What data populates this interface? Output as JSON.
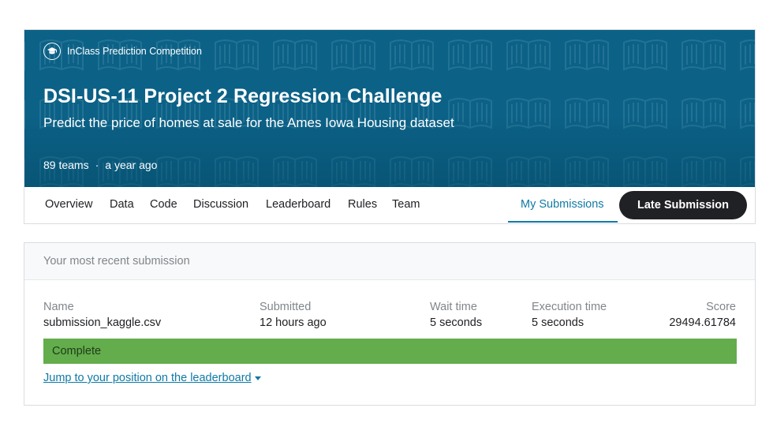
{
  "competition": {
    "type_label": "InClass Prediction Competition",
    "title": "DSI-US-11 Project 2 Regression Challenge",
    "subtitle": "Predict the price of homes at sale for the Ames Iowa Housing dataset",
    "teams": "89 teams",
    "separator": "·",
    "age": "a year ago"
  },
  "tabs": [
    {
      "label": "Overview"
    },
    {
      "label": "Data"
    },
    {
      "label": "Code"
    },
    {
      "label": "Discussion"
    },
    {
      "label": "Leaderboard"
    },
    {
      "label": "Rules"
    },
    {
      "label": "Team"
    },
    {
      "label": "My Submissions",
      "active": true
    }
  ],
  "late_submission_label": "Late Submission",
  "submission": {
    "header": "Your most recent submission",
    "columns": {
      "name": {
        "label": "Name",
        "value": "submission_kaggle.csv"
      },
      "submitted": {
        "label": "Submitted",
        "value": "12 hours ago"
      },
      "wait": {
        "label": "Wait time",
        "value": "5 seconds"
      },
      "execution": {
        "label": "Execution time",
        "value": "5 seconds"
      },
      "score": {
        "label": "Score",
        "value": "29494.61784"
      }
    },
    "status": "Complete",
    "jump_link": "Jump to your position on the leaderboard"
  },
  "colors": {
    "banner": "#0c6186",
    "accent": "#0f7aa5",
    "status_complete": "#63ad4c",
    "button_dark": "#202124"
  },
  "icons": {
    "competition_type": "graduation-cap-icon",
    "jump_caret": "caret-down-icon"
  }
}
